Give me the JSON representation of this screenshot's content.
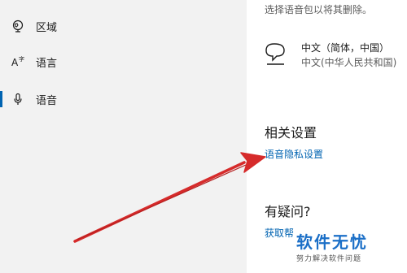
{
  "sidebar": {
    "items": [
      {
        "label": "区域",
        "icon": "region-icon",
        "selected": false
      },
      {
        "label": "语言",
        "icon": "language-icon",
        "selected": false
      },
      {
        "label": "语音",
        "icon": "microphone-icon",
        "selected": true
      }
    ]
  },
  "content": {
    "top_note": "选择语音包以将其删除。",
    "language_pack": {
      "name": "中文（简体，中国）",
      "subtitle": "中文(中华人民共和国)",
      "icon": "speech-bubble-icon"
    },
    "related_settings": {
      "title": "相关设置",
      "link": "语音隐私设置"
    },
    "help": {
      "title": "有疑问?",
      "link": "获取帮"
    }
  },
  "watermark": {
    "main": "软件无忧",
    "sub": "努力解决软件问题"
  },
  "colors": {
    "sidebar_bg": "#f2f2f2",
    "accent": "#0063b1",
    "arrow": "#d62b2b",
    "watermark": "#1b6fc7"
  }
}
